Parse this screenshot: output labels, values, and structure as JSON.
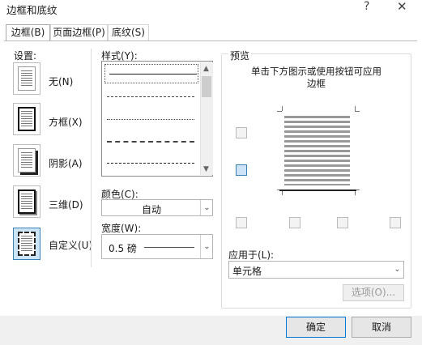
{
  "window": {
    "title": "边框和底纹",
    "help": "?",
    "close": "✕"
  },
  "tabs": [
    {
      "label": "边框(B)",
      "active": true
    },
    {
      "label": "页面边框(P)",
      "active": false
    },
    {
      "label": "底纹(S)",
      "active": false
    }
  ],
  "settings": {
    "label": "设置:",
    "items": [
      {
        "label": "无(N)"
      },
      {
        "label": "方框(X)"
      },
      {
        "label": "阴影(A)"
      },
      {
        "label": "三维(D)"
      },
      {
        "label": "自定义(U)"
      }
    ]
  },
  "style": {
    "label": "样式(Y):"
  },
  "color": {
    "label": "颜色(C):",
    "value": "自动"
  },
  "width": {
    "label": "宽度(W):",
    "value": "0.5 磅"
  },
  "preview": {
    "label": "预览",
    "hint_line1": "单击下方图示或使用按钮可应用",
    "hint_line2": "边框"
  },
  "apply_to": {
    "label": "应用于(L):",
    "value": "单元格"
  },
  "options_button": "选项(O)...",
  "ok_button": "确定",
  "cancel_button": "取消",
  "icons": {
    "dropdown": "chevron-down-icon",
    "scroll_up": "chevron-up-icon"
  }
}
